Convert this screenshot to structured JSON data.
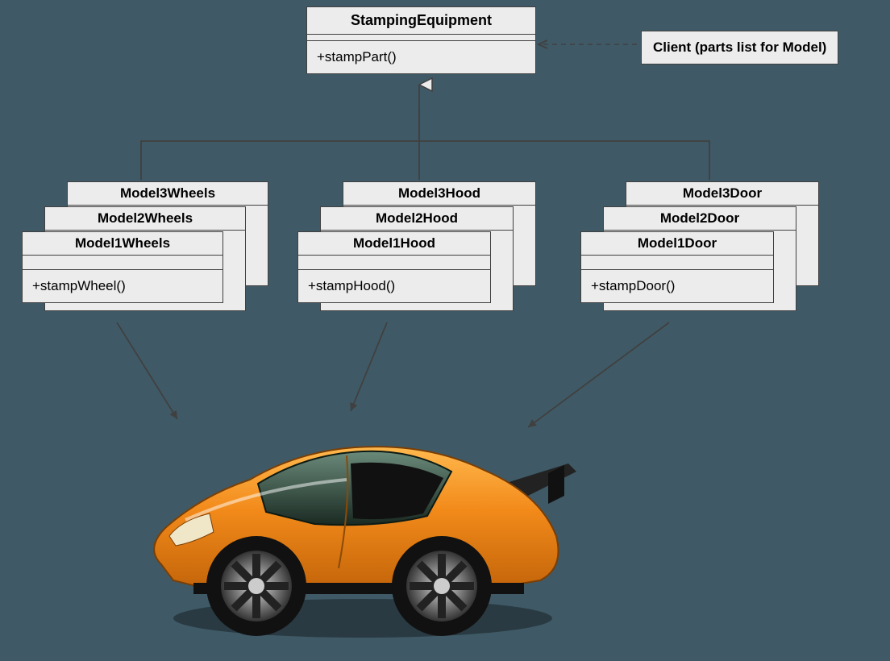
{
  "parent": {
    "title": "StampingEquipment",
    "op": "+stampPart()"
  },
  "client": {
    "label": "Client (parts list for Model)"
  },
  "groups": [
    {
      "titles": [
        "Model3Wheels",
        "Model2Wheels",
        "Model1Wheels"
      ],
      "op": "+stampWheel()"
    },
    {
      "titles": [
        "Model3Hood",
        "Model2Hood",
        "Model1Hood"
      ],
      "op": "+stampHood()"
    },
    {
      "titles": [
        "Model3Door",
        "Model2Door",
        "Model1Door"
      ],
      "op": "+stampDoor()"
    }
  ],
  "colors": {
    "box_bg": "#ececec",
    "box_border": "#404040",
    "page_bg": "#3f5a66",
    "car_body": "#f28a1a",
    "car_dark": "#222"
  }
}
